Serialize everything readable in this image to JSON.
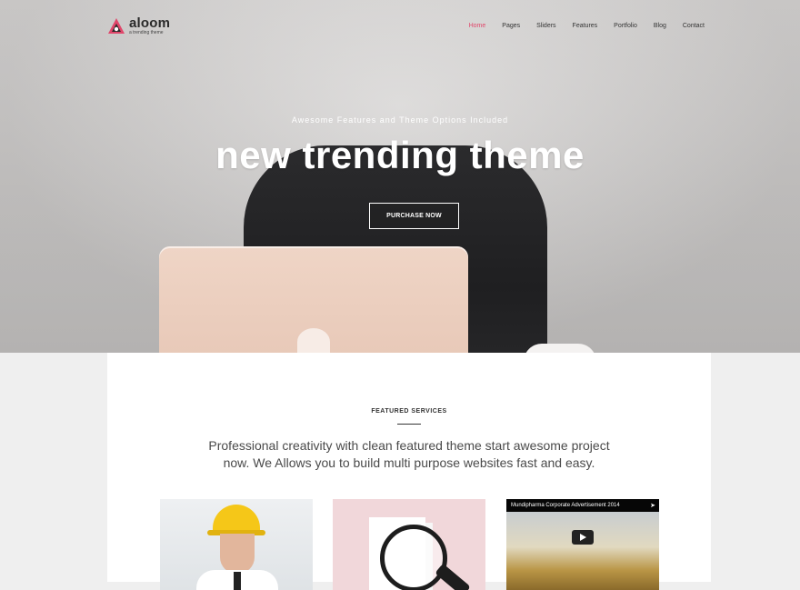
{
  "brand": {
    "name": "aloom",
    "tagline": "a trending theme",
    "accent_color": "#e0466a"
  },
  "nav": {
    "items": [
      {
        "label": "Home",
        "active": true
      },
      {
        "label": "Pages",
        "active": false
      },
      {
        "label": "Sliders",
        "active": false
      },
      {
        "label": "Features",
        "active": false
      },
      {
        "label": "Portfolio",
        "active": false
      },
      {
        "label": "Blog",
        "active": false
      },
      {
        "label": "Contact",
        "active": false
      }
    ]
  },
  "hero": {
    "subtitle": "Awesome Features and Theme Options Included",
    "title": "new trending theme",
    "button_label": "PURCHASE NOW"
  },
  "services": {
    "label": "FEATURED SERVICES",
    "text": "Professional creativity with clean featured theme start awesome project now. We Allows you to build multi purpose websites fast and easy.",
    "video": {
      "title": "Mundipharma Corporate Advertisement 2014",
      "share_icon": "share-icon",
      "play_icon": "play-icon"
    }
  }
}
